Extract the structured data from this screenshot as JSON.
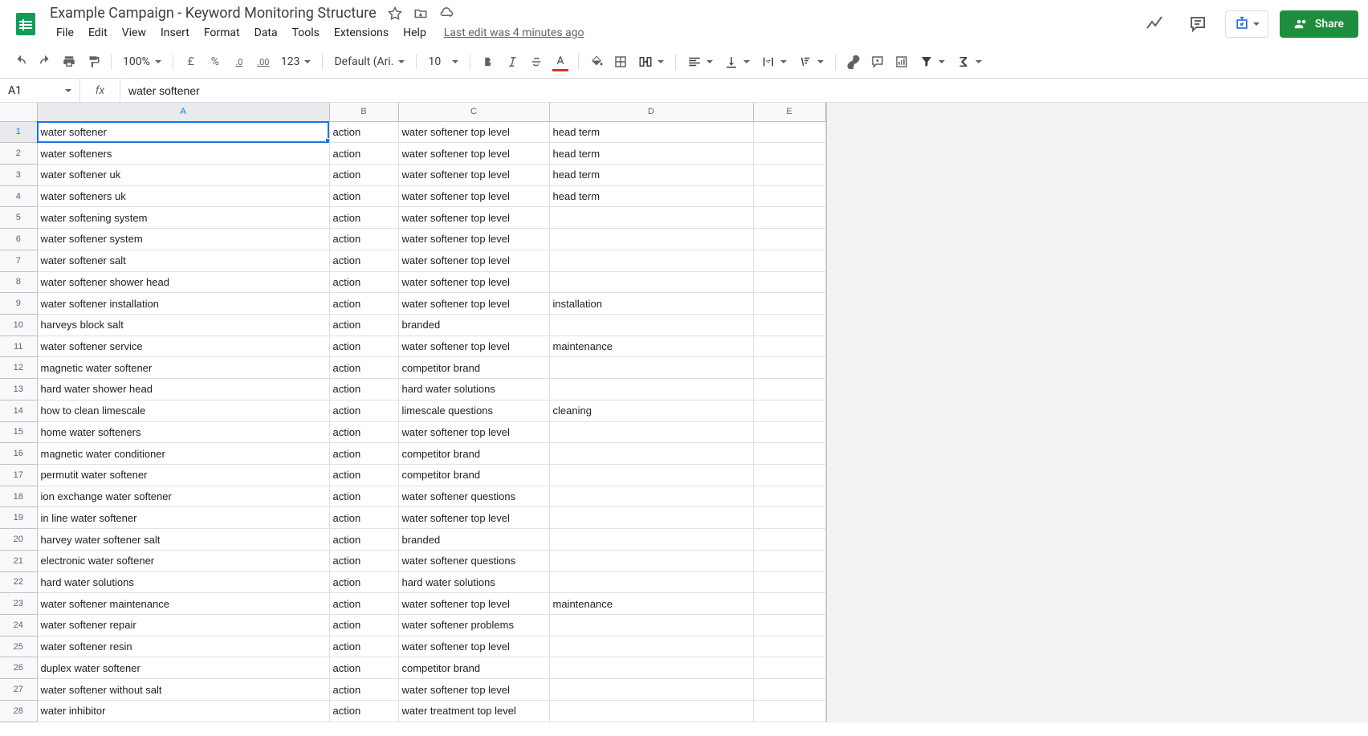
{
  "doc": {
    "title": "Example Campaign - Keyword Monitoring Structure"
  },
  "menubar": {
    "file": "File",
    "edit": "Edit",
    "view": "View",
    "insert": "Insert",
    "format": "Format",
    "data": "Data",
    "tools": "Tools",
    "extensions": "Extensions",
    "help": "Help",
    "last_edit": "Last edit was 4 minutes ago"
  },
  "header": {
    "share": "Share"
  },
  "toolbar": {
    "zoom": "100%",
    "currency": "£",
    "percent": "%",
    "dec_decrease": ".0",
    "dec_increase": ".00",
    "more_formats": "123",
    "font": "Default (Ari...",
    "font_size": "10"
  },
  "formula_bar": {
    "name_box": "A1",
    "formula": "water softener"
  },
  "columns": [
    "A",
    "B",
    "C",
    "D",
    "E"
  ],
  "rows": [
    {
      "n": 1,
      "a": "water softener",
      "b": "action",
      "c": "water softener top level",
      "d": "head term",
      "e": ""
    },
    {
      "n": 2,
      "a": "water softeners",
      "b": "action",
      "c": "water softener top level",
      "d": "head term",
      "e": ""
    },
    {
      "n": 3,
      "a": "water softener uk",
      "b": "action",
      "c": "water softener top level",
      "d": "head term",
      "e": ""
    },
    {
      "n": 4,
      "a": "water softeners uk",
      "b": "action",
      "c": "water softener top level",
      "d": "head term",
      "e": ""
    },
    {
      "n": 5,
      "a": "water softening system",
      "b": "action",
      "c": "water softener top level",
      "d": "",
      "e": ""
    },
    {
      "n": 6,
      "a": "water softener system",
      "b": "action",
      "c": "water softener top level",
      "d": "",
      "e": ""
    },
    {
      "n": 7,
      "a": "water softener salt",
      "b": "action",
      "c": "water softener top level",
      "d": "",
      "e": ""
    },
    {
      "n": 8,
      "a": "water softener shower head",
      "b": "action",
      "c": "water softener top level",
      "d": "",
      "e": ""
    },
    {
      "n": 9,
      "a": "water softener installation",
      "b": "action",
      "c": "water softener top level",
      "d": "installation",
      "e": ""
    },
    {
      "n": 10,
      "a": "harveys block salt",
      "b": "action",
      "c": "branded",
      "d": "",
      "e": ""
    },
    {
      "n": 11,
      "a": "water softener service",
      "b": "action",
      "c": "water softener top level",
      "d": "maintenance",
      "e": ""
    },
    {
      "n": 12,
      "a": "magnetic water softener",
      "b": "action",
      "c": "competitor brand",
      "d": "",
      "e": ""
    },
    {
      "n": 13,
      "a": "hard water shower head",
      "b": "action",
      "c": "hard water solutions",
      "d": "",
      "e": ""
    },
    {
      "n": 14,
      "a": "how to clean limescale",
      "b": "action",
      "c": "limescale questions",
      "d": "cleaning",
      "e": ""
    },
    {
      "n": 15,
      "a": "home water softeners",
      "b": "action",
      "c": "water softener top level",
      "d": "",
      "e": ""
    },
    {
      "n": 16,
      "a": "magnetic water conditioner",
      "b": "action",
      "c": "competitor brand",
      "d": "",
      "e": ""
    },
    {
      "n": 17,
      "a": "permutit water softener",
      "b": "action",
      "c": "competitor brand",
      "d": "",
      "e": ""
    },
    {
      "n": 18,
      "a": "ion exchange water softener",
      "b": "action",
      "c": "water softener questions",
      "d": "",
      "e": ""
    },
    {
      "n": 19,
      "a": "in line water softener",
      "b": "action",
      "c": "water softener top level",
      "d": "",
      "e": ""
    },
    {
      "n": 20,
      "a": "harvey water softener salt",
      "b": "action",
      "c": "branded",
      "d": "",
      "e": ""
    },
    {
      "n": 21,
      "a": "electronic water softener",
      "b": "action",
      "c": "water softener questions",
      "d": "",
      "e": ""
    },
    {
      "n": 22,
      "a": "hard water solutions",
      "b": "action",
      "c": "hard water solutions",
      "d": "",
      "e": ""
    },
    {
      "n": 23,
      "a": "water softener maintenance",
      "b": "action",
      "c": "water softener top level",
      "d": "maintenance",
      "e": ""
    },
    {
      "n": 24,
      "a": "water softener repair",
      "b": "action",
      "c": "water softener problems",
      "d": "",
      "e": ""
    },
    {
      "n": 25,
      "a": "water softener resin",
      "b": "action",
      "c": "water softener top level",
      "d": "",
      "e": ""
    },
    {
      "n": 26,
      "a": "duplex water softener",
      "b": "action",
      "c": "competitor brand",
      "d": "",
      "e": ""
    },
    {
      "n": 27,
      "a": "water softener without salt",
      "b": "action",
      "c": "water softener top level",
      "d": "",
      "e": ""
    },
    {
      "n": 28,
      "a": "water inhibitor",
      "b": "action",
      "c": "water treatment top level",
      "d": "",
      "e": ""
    }
  ],
  "active_cell": {
    "row": 1,
    "col": "a"
  }
}
